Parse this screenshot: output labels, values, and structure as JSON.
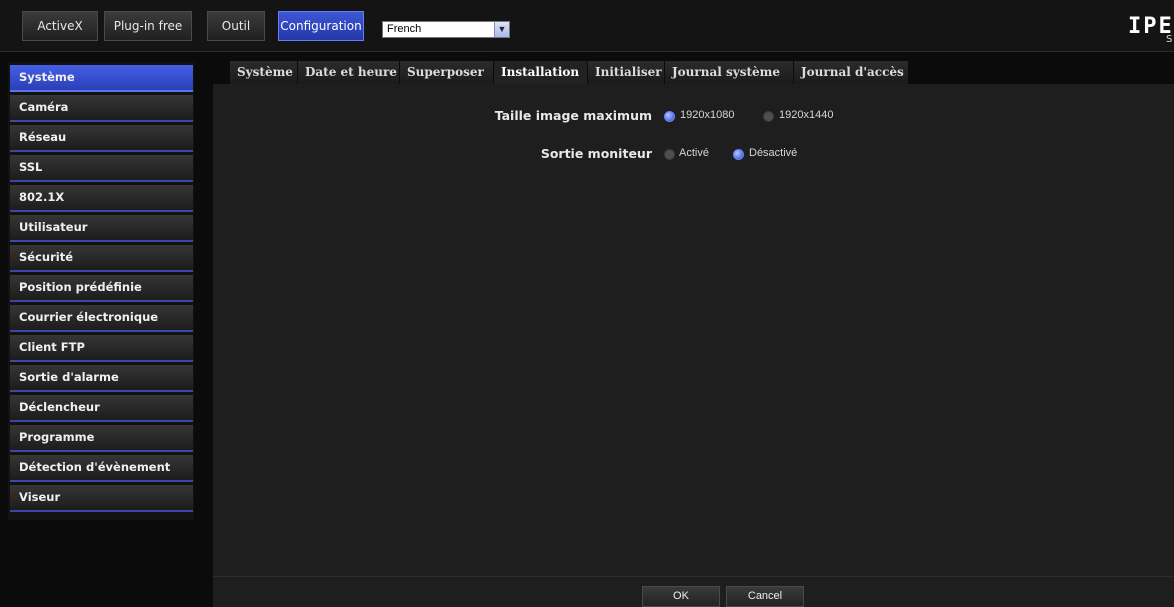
{
  "topbar": {
    "buttons": [
      "ActiveX",
      "Plug-in free",
      "Outil",
      "Configuration"
    ],
    "active": "Configuration",
    "language": {
      "selected": "French"
    },
    "logo_text": "IPE",
    "logo_sub": "S"
  },
  "sidebar": {
    "items": [
      "Système",
      "Caméra",
      "Réseau",
      "SSL",
      "802.1X",
      "Utilisateur",
      "Sécurité",
      "Position prédéfinie",
      "Courrier électronique",
      "Client FTP",
      "Sortie d'alarme",
      "Déclencheur",
      "Programme",
      "Détection d'évènement",
      "Viseur"
    ],
    "active": "Système"
  },
  "tabs": {
    "items": [
      "Système",
      "Date et heure",
      "Superposer",
      "Installation",
      "Initialiser",
      "Journal système",
      "Journal d'accès"
    ],
    "active": "Installation"
  },
  "settings": {
    "max_image_size": {
      "label": "Taille image maximum",
      "options": [
        "1920x1080",
        "1920x1440"
      ],
      "selected": "1920x1080"
    },
    "monitor_output": {
      "label": "Sortie moniteur",
      "options": [
        "Activé",
        "Désactivé"
      ],
      "selected": "Désactivé"
    }
  },
  "footer": {
    "ok_label": "OK",
    "cancel_label": "Cancel"
  },
  "colors": {
    "accent": "#3450c8",
    "background": "#1e1e1e",
    "topbar": "#141414"
  }
}
